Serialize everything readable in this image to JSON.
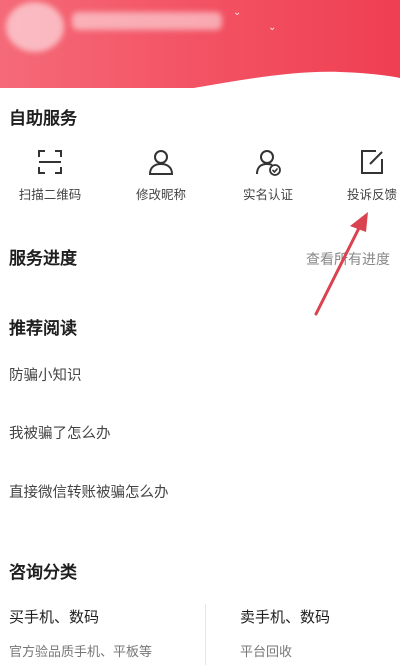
{
  "header": {
    "avatar_icon": "avatar-blurred",
    "username_label": "",
    "colors": {
      "gradient_start": "#f56a78",
      "gradient_end": "#ef3f52"
    }
  },
  "self_service": {
    "title": "自助服务",
    "items": [
      {
        "label": "扫描二维码",
        "icon": "scan-qr-icon"
      },
      {
        "label": "修改昵称",
        "icon": "user-icon"
      },
      {
        "label": "实名认证",
        "icon": "verified-user-icon"
      },
      {
        "label": "投诉反馈",
        "icon": "edit-note-icon"
      }
    ]
  },
  "service_progress": {
    "title": "服务进度",
    "link": "查看所有进度"
  },
  "recommended": {
    "title": "推荐阅读",
    "items": [
      {
        "label": "防骗小知识"
      },
      {
        "label": "我被骗了怎么办"
      },
      {
        "label": "直接微信转账被骗怎么办"
      }
    ]
  },
  "consult": {
    "title": "咨询分类",
    "categories": [
      {
        "title": "买手机、数码",
        "subtitle": "官方验品质手机、平板等"
      },
      {
        "title": "卖手机、数码",
        "subtitle": "平台回收"
      }
    ]
  },
  "annotation": {
    "arrow_color": "#d9434f"
  }
}
